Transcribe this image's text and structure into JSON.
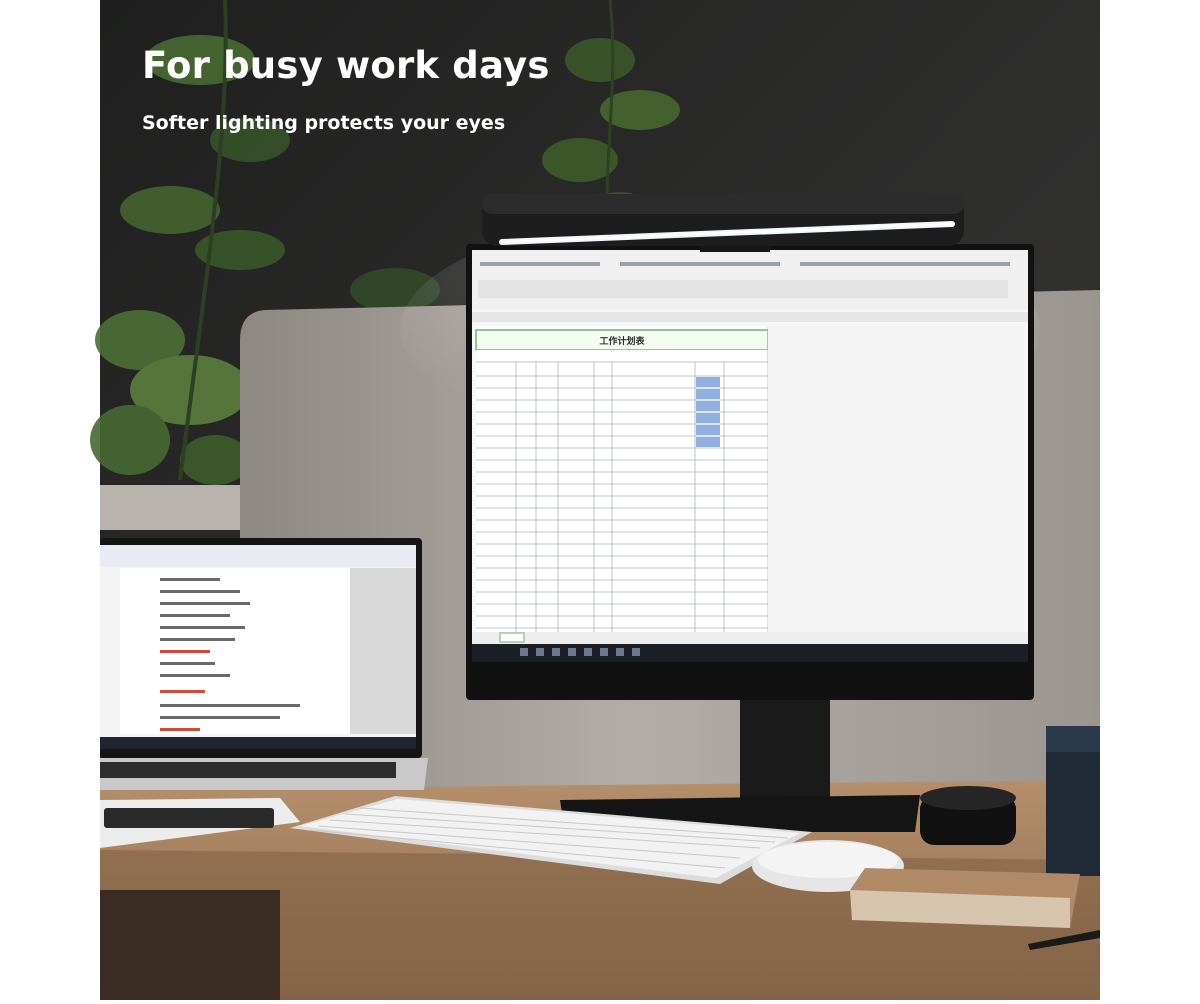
{
  "headline": "For busy work days",
  "subheadline": "Softer lighting protects your eyes",
  "monitor_screen": {
    "spreadsheet_title": "工作计划表"
  },
  "objects": {
    "lamp": "light-bar-icon",
    "monitor": "monitor-icon",
    "laptop": "laptop-icon",
    "keyboard": "keyboard-icon",
    "mouse": "mouse-icon",
    "speaker": "speaker-icon",
    "notebook": "notebook-icon",
    "pen": "pen-icon",
    "plants": "plant-icon"
  },
  "colors": {
    "background_white": "#ffffff",
    "wall_dark": "#2b2b2b",
    "desk_wood": "#a07a56",
    "light_glow": "#eef4ff",
    "sheet_green": "#6fb36f",
    "cell_blue": "#8fb0e0"
  }
}
